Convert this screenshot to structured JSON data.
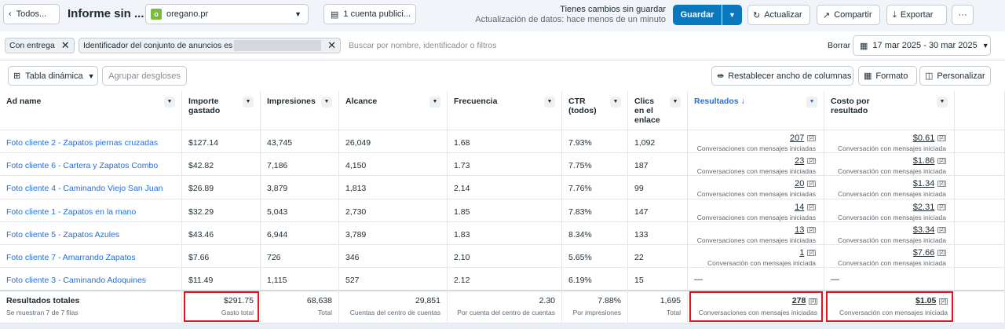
{
  "top": {
    "back_label": "Todos...",
    "report_title": "Informe sin ...",
    "account": "oregano.pr",
    "account_logo_letter": "o",
    "pub_accounts": "1 cuenta publici...",
    "unsaved_title": "Tienes cambios sin guardar",
    "unsaved_sub": "Actualización de datos: hace menos de un minuto",
    "save": "Guardar",
    "update": "Actualizar",
    "share": "Compartir",
    "export": "Exportar",
    "more": "···"
  },
  "filters": {
    "chip1": "Con entrega",
    "chip2": "Identificador del conjunto de anuncios es",
    "search_placeholder": "Buscar por nombre, identificador o filtros",
    "clear": "Borrar",
    "date_range": "17 mar 2025 - 30 mar 2025"
  },
  "toolbar": {
    "pivot": "Tabla dinámica",
    "group": "Agrupar desgloses",
    "reset_widths": "Restablecer ancho de columnas",
    "format": "Formato",
    "personalize": "Personalizar"
  },
  "headers": [
    "Ad name",
    "Importe gastado",
    "Impresiones",
    "Alcance",
    "Frecuencia",
    "CTR (todos)",
    "Clics en el enlace",
    "Resultados ↓",
    "Costo por resultado"
  ],
  "rows": [
    {
      "name": "Foto cliente 2 - Zapatos piernas cruzadas",
      "spend": "$127.14",
      "impr": "43,745",
      "reach": "26,049",
      "freq": "1.68",
      "ctr": "7.93%",
      "clicks": "1,092",
      "res": "207",
      "res_sub": "Conversaciones con mensajes iniciadas",
      "cost": "$0.61",
      "cost_sub": "Conversación con mensajes iniciada"
    },
    {
      "name": "Foto cliente 6 - Cartera y Zapatos Combo",
      "spend": "$42.82",
      "impr": "7,186",
      "reach": "4,150",
      "freq": "1.73",
      "ctr": "7.75%",
      "clicks": "187",
      "res": "23",
      "res_sub": "Conversaciones con mensajes iniciadas",
      "cost": "$1.86",
      "cost_sub": "Conversación con mensajes iniciada"
    },
    {
      "name": "Foto cliente 4 - Caminando Viejo San Juan",
      "spend": "$26.89",
      "impr": "3,879",
      "reach": "1,813",
      "freq": "2.14",
      "ctr": "7.76%",
      "clicks": "99",
      "res": "20",
      "res_sub": "Conversaciones con mensajes iniciadas",
      "cost": "$1.34",
      "cost_sub": "Conversación con mensajes iniciada"
    },
    {
      "name": "Foto cliente 1 - Zapatos en la mano",
      "spend": "$32.29",
      "impr": "5,043",
      "reach": "2,730",
      "freq": "1.85",
      "ctr": "7.83%",
      "clicks": "147",
      "res": "14",
      "res_sub": "Conversaciones con mensajes iniciadas",
      "cost": "$2.31",
      "cost_sub": "Conversación con mensajes iniciada"
    },
    {
      "name": "Foto cliente 5 - Zapatos Azules",
      "spend": "$43.46",
      "impr": "6,944",
      "reach": "3,789",
      "freq": "1.83",
      "ctr": "8.34%",
      "clicks": "133",
      "res": "13",
      "res_sub": "Conversaciones con mensajes iniciadas",
      "cost": "$3.34",
      "cost_sub": "Conversación con mensajes iniciada"
    },
    {
      "name": "Foto cliente 7 - Amarrando Zapatos",
      "spend": "$7.66",
      "impr": "726",
      "reach": "346",
      "freq": "2.10",
      "ctr": "5.65%",
      "clicks": "22",
      "res": "1",
      "res_sub": "Conversación con mensajes iniciada",
      "cost": "$7.66",
      "cost_sub": "Conversación con mensajes iniciada"
    },
    {
      "name": "Foto cliente 3 - Caminando Adoquines",
      "spend": "$11.49",
      "impr": "1,115",
      "reach": "527",
      "freq": "2.12",
      "ctr": "6.19%",
      "clicks": "15",
      "res": "—",
      "res_sub": "",
      "cost": "—",
      "cost_sub": ""
    }
  ],
  "totals": {
    "label": "Resultados totales",
    "sub": "Se muestran 7 de 7 filas",
    "spend": "$291.75",
    "spend_sub": "Gasto total",
    "impr": "68,638",
    "impr_sub": "Total",
    "reach": "29,851",
    "reach_sub": "Cuentas del centro de cuentas",
    "freq": "2.30",
    "freq_sub": "Por cuenta del centro de cuentas",
    "ctr": "7.88%",
    "ctr_sub": "Por impresiones",
    "clicks": "1,695",
    "clicks_sub": "Total",
    "res": "278",
    "res_sub": "Conversaciones con mensajes iniciadas",
    "cost": "$1.05",
    "cost_sub": "Conversación con mensajes iniciada"
  },
  "info_tag": "[2]",
  "colors": {
    "accent": "#0a78be",
    "link": "#216fdb",
    "highlight": "#e0141e"
  }
}
